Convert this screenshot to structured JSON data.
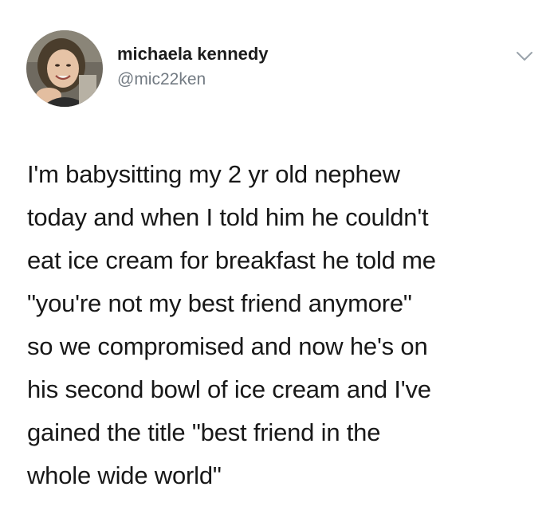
{
  "author": {
    "display_name": "michaela kennedy",
    "handle": "@mic22ken",
    "avatar_icon": "profile-photo"
  },
  "menu_icon": "chevron-down-icon",
  "tweet": {
    "lines": [
      "I'm babysitting my 2 yr old nephew",
      "today and when I told him he couldn't",
      "eat ice cream for breakfast he told me",
      "\"you're not my best friend anymore\"",
      "so we compromised and now he's on",
      "his second bowl of ice cream and I've",
      "gained the title \"best friend in the",
      "whole wide world\""
    ]
  },
  "colors": {
    "name": "#1c1c1c",
    "handle": "#737b83",
    "text": "#181818",
    "background": "#ffffff"
  }
}
